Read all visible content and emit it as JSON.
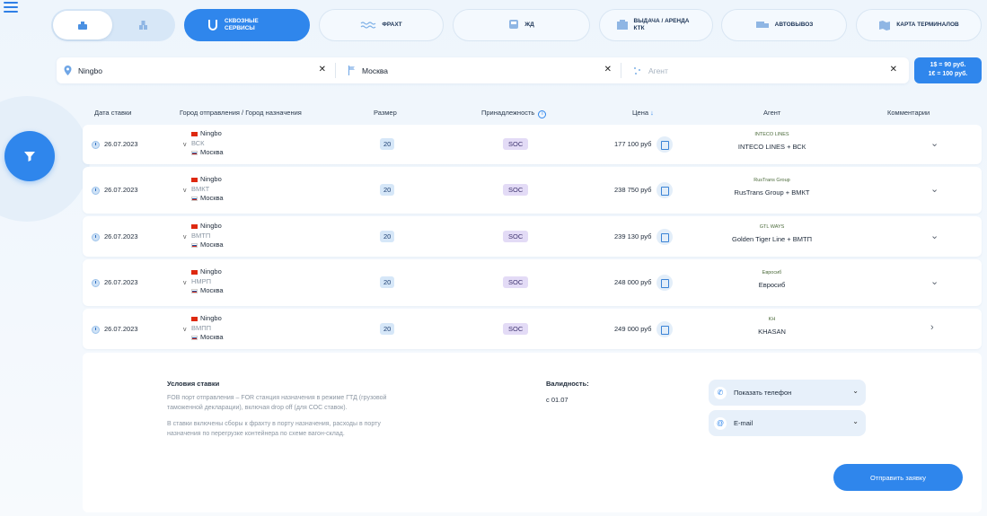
{
  "nav": {
    "tabs": [
      {
        "id": "through",
        "label": "Сквозные сервисы",
        "active": true,
        "icon": "magnet-icon"
      },
      {
        "id": "freight",
        "label": "Фрахт",
        "active": false,
        "icon": "waves-icon"
      },
      {
        "id": "rail",
        "label": "ЖД",
        "active": false,
        "icon": "train-icon"
      },
      {
        "id": "ktk",
        "label": "Выдача / аренда КТК",
        "active": false,
        "icon": "container-icon"
      },
      {
        "id": "auto",
        "label": "Автовывоз",
        "active": false,
        "icon": "truck-icon"
      },
      {
        "id": "terminals",
        "label": "Карта терминалов",
        "active": false,
        "icon": "map-icon"
      }
    ]
  },
  "filters": {
    "origin": "Ningbo",
    "destination": "Москва",
    "agent_placeholder": "Агент"
  },
  "rates": {
    "usd": "1$ = 90 руб.",
    "eur": "1€ = 100 руб."
  },
  "table": {
    "headers": {
      "date": "Дата ставки",
      "route": "Город отправления / Город назначения",
      "size": "Размер",
      "ownership": "Принадлежность",
      "price": "Цена",
      "agent": "Агент",
      "comments": "Комментарии"
    },
    "rows": [
      {
        "date": "26.07.2023",
        "from": "Ningbo",
        "via": "ВСК",
        "to": "Москва",
        "size": "20",
        "ownership": "SOC",
        "price": "177 100 руб",
        "agent_logo": "INTECO LINES",
        "agent": "INTECO LINES + ВСК"
      },
      {
        "date": "26.07.2023",
        "from": "Ningbo",
        "via": "ВМКТ",
        "to": "Москва",
        "size": "20",
        "ownership": "SOC",
        "price": "238 750 руб",
        "agent_logo": "RusTrans Group",
        "agent": "RusTrans Group + ВМКТ"
      },
      {
        "date": "26.07.2023",
        "from": "Ningbo",
        "via": "ВМТП",
        "to": "Москва",
        "size": "20",
        "ownership": "SOC",
        "price": "239 130 руб",
        "agent_logo": "GTL WAYS",
        "agent": "Golden Tiger Line + ВМТП"
      },
      {
        "date": "26.07.2023",
        "from": "Ningbo",
        "via": "НМРП",
        "to": "Москва",
        "size": "20",
        "ownership": "SOC",
        "price": "248 000 руб",
        "agent_logo": "Евросиб",
        "agent": "Евросиб"
      },
      {
        "date": "26.07.2023",
        "from": "Ningbo",
        "via": "ВМПП",
        "to": "Москва",
        "size": "20",
        "ownership": "SOC",
        "price": "249 000 руб",
        "agent_logo": "KH",
        "agent": "KHASAN"
      }
    ]
  },
  "details": {
    "conditions_title": "Условия ставки",
    "conditions_p1": "FOB порт отправления – FOR станция назначения в режиме ГТД (грузовой таможенной декларации), включая drop off (для СОС ставок).",
    "conditions_p2": "В ставки включены сборы к фрахту в порту назначения, расходы в порту назначения по перегрузке контейнера по схеме вагон-склад.",
    "validity_title": "Валидность:",
    "validity_value": "с 01.07",
    "show_phone": "Показать телефон",
    "email": "E-mail",
    "submit": "Отправить заявку"
  },
  "colors": {
    "accent": "#2f86ec",
    "soc_pill": "#e3dbf6",
    "size_pill": "#d6e7f8"
  }
}
